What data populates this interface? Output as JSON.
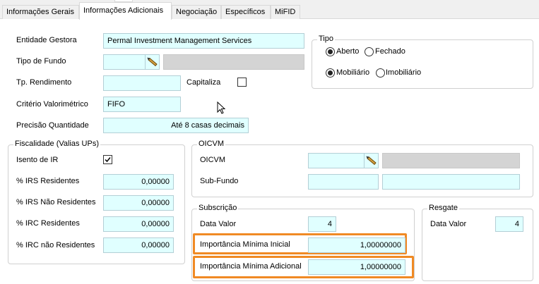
{
  "tabs": [
    {
      "label": "Informações Gerais",
      "active": false
    },
    {
      "label": "Informações Adicionais",
      "active": true
    },
    {
      "label": "Negociação",
      "active": false
    },
    {
      "label": "Específicos",
      "active": false
    },
    {
      "label": "MiFID",
      "active": false
    }
  ],
  "main": {
    "entidade_gestora": {
      "label": "Entidade Gestora",
      "value": "Permal Investment Management Services"
    },
    "tipo_fundo": {
      "label": "Tipo de Fundo",
      "value": "",
      "description": ""
    },
    "tp_rendimento": {
      "label": "Tp. Rendimento",
      "value": ""
    },
    "capitaliza": {
      "label": "Capitaliza",
      "checked": false
    },
    "criterio_valorimetrico": {
      "label": "Critério Valorimétrico",
      "value": "FIFO"
    },
    "precisao_quantidade": {
      "label": "Precisão Quantidade",
      "value": "Até 8 casas decimais"
    }
  },
  "tipo": {
    "title": "Tipo",
    "row1": [
      {
        "label": "Aberto",
        "selected": true
      },
      {
        "label": "Fechado",
        "selected": false
      }
    ],
    "row2": [
      {
        "label": "Mobiliário",
        "selected": true
      },
      {
        "label": "Imobiliário",
        "selected": false
      }
    ]
  },
  "fiscalidade": {
    "title": "Fiscalidade (Valias UPs)",
    "isento_ir": {
      "label": "Isento de IR",
      "checked": true
    },
    "irs_residentes": {
      "label": "% IRS Residentes",
      "value": "0,00000"
    },
    "irs_nao_residentes": {
      "label": "% IRS Não Residentes",
      "value": "0,00000"
    },
    "irc_residentes": {
      "label": "% IRC Residentes",
      "value": "0,00000"
    },
    "irc_nao_residentes": {
      "label": "% IRC não Residentes",
      "value": "0,00000"
    }
  },
  "oicvm": {
    "title": "OICVM",
    "oicvm": {
      "label": "OICVM",
      "value": "",
      "description": ""
    },
    "sub_fundo": {
      "label": "Sub-Fundo",
      "value": "",
      "description": ""
    }
  },
  "subscricao": {
    "title": "Subscrição",
    "data_valor": {
      "label": "Data Valor",
      "value": "4"
    },
    "importancia_minima_inicial": {
      "label": "Importância Mínima Inicial",
      "value": "1,00000000"
    },
    "importancia_minima_adicional": {
      "label": "Importância Mínima Adicional",
      "value": "1,00000000"
    }
  },
  "resgate": {
    "title": "Resgate",
    "data_valor": {
      "label": "Data Valor",
      "value": "4"
    }
  },
  "colors": {
    "field_bg": "#e0ffff",
    "highlight": "#f08a24",
    "disabled_field": "#d4d4d4"
  }
}
